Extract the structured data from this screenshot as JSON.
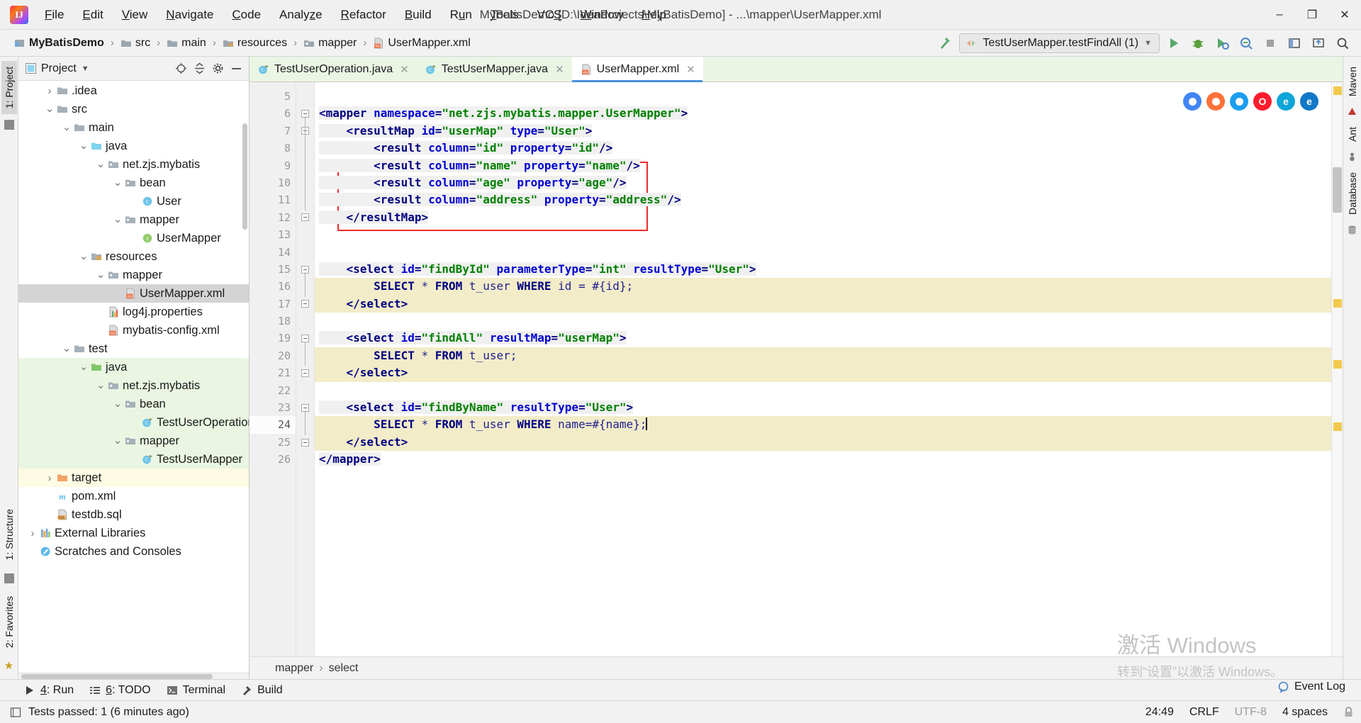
{
  "window": {
    "title": "MyBatisDemo [D:\\IdeaProjects\\MyBatisDemo] - ...\\mapper\\UserMapper.xml",
    "minimize": "–",
    "maximize": "❐",
    "close": "✕"
  },
  "menubar": [
    {
      "label": "File"
    },
    {
      "label": "Edit"
    },
    {
      "label": "View"
    },
    {
      "label": "Navigate"
    },
    {
      "label": "Code"
    },
    {
      "label": "Analyze"
    },
    {
      "label": "Refactor"
    },
    {
      "label": "Build"
    },
    {
      "label": "Run"
    },
    {
      "label": "Tools"
    },
    {
      "label": "VCS"
    },
    {
      "label": "Window"
    },
    {
      "label": "Help"
    }
  ],
  "breadcrumb": [
    {
      "label": "MyBatisDemo",
      "icon": "module-icon"
    },
    {
      "label": "src",
      "icon": "folder-icon"
    },
    {
      "label": "main",
      "icon": "folder-icon"
    },
    {
      "label": "resources",
      "icon": "resources-folder-icon"
    },
    {
      "label": "mapper",
      "icon": "package-folder-icon"
    },
    {
      "label": "UserMapper.xml",
      "icon": "xml-file-icon"
    }
  ],
  "toolbar": {
    "build_icon": "hammer-icon",
    "run_config": "TestUserMapper.testFindAll (1)",
    "run_label": "run-button",
    "debug_label": "debug-button",
    "coverage_label": "run-with-coverage-button",
    "profile_label": "profiler-button",
    "stop_label": "stop-button",
    "layout_label": "layout-button",
    "updates_label": "updates-button",
    "search_label": "search-everywhere-button"
  },
  "left_rail": [
    {
      "label": "1: Project",
      "selected": true
    },
    {
      "label": "1: Structure",
      "selected": false
    },
    {
      "label": "2: Favorites",
      "selected": false
    }
  ],
  "right_rail": [
    {
      "label": "Maven"
    },
    {
      "label": "Ant"
    },
    {
      "label": "Database"
    }
  ],
  "project_panel": {
    "title": "Project",
    "dropdown_icon": "chevron-down-icon",
    "actions": [
      "locate-icon",
      "collapse-all-icon",
      "settings-icon",
      "hide-icon"
    ],
    "tree": [
      {
        "label": ".idea",
        "indent": 1,
        "arrow": "collapsed",
        "icon": "folder-gray",
        "state": ""
      },
      {
        "label": "src",
        "indent": 1,
        "arrow": "expanded",
        "icon": "folder-gray",
        "state": ""
      },
      {
        "label": "main",
        "indent": 2,
        "arrow": "expanded",
        "icon": "folder-gray",
        "state": ""
      },
      {
        "label": "java",
        "indent": 3,
        "arrow": "expanded",
        "icon": "folder-blue",
        "state": ""
      },
      {
        "label": "net.zjs.mybatis",
        "indent": 4,
        "arrow": "expanded",
        "icon": "package",
        "state": ""
      },
      {
        "label": "bean",
        "indent": 5,
        "arrow": "expanded",
        "icon": "package",
        "state": ""
      },
      {
        "label": "User",
        "indent": 6,
        "arrow": "none",
        "icon": "class",
        "state": ""
      },
      {
        "label": "mapper",
        "indent": 5,
        "arrow": "expanded",
        "icon": "package",
        "state": ""
      },
      {
        "label": "UserMapper",
        "indent": 6,
        "arrow": "none",
        "icon": "interface",
        "state": ""
      },
      {
        "label": "resources",
        "indent": 3,
        "arrow": "expanded",
        "icon": "folder-resources",
        "state": ""
      },
      {
        "label": "mapper",
        "indent": 4,
        "arrow": "expanded",
        "icon": "package",
        "state": ""
      },
      {
        "label": "UserMapper.xml",
        "indent": 5,
        "arrow": "none",
        "icon": "xml",
        "state": "sel"
      },
      {
        "label": "log4j.properties",
        "indent": 4,
        "arrow": "none",
        "icon": "properties",
        "state": ""
      },
      {
        "label": "mybatis-config.xml",
        "indent": 4,
        "arrow": "none",
        "icon": "xml",
        "state": ""
      },
      {
        "label": "test",
        "indent": 2,
        "arrow": "expanded",
        "icon": "folder-gray",
        "state": ""
      },
      {
        "label": "java",
        "indent": 3,
        "arrow": "expanded",
        "icon": "folder-green",
        "state": "green"
      },
      {
        "label": "net.zjs.mybatis",
        "indent": 4,
        "arrow": "expanded",
        "icon": "package",
        "state": "green"
      },
      {
        "label": "bean",
        "indent": 5,
        "arrow": "expanded",
        "icon": "package",
        "state": "green"
      },
      {
        "label": "TestUserOperation",
        "indent": 6,
        "arrow": "none",
        "icon": "test-class",
        "state": "green"
      },
      {
        "label": "mapper",
        "indent": 5,
        "arrow": "expanded",
        "icon": "package",
        "state": "green"
      },
      {
        "label": "TestUserMapper",
        "indent": 6,
        "arrow": "none",
        "icon": "test-class",
        "state": "green"
      },
      {
        "label": "target",
        "indent": 1,
        "arrow": "collapsed",
        "icon": "folder-orange",
        "state": "yellow"
      },
      {
        "label": "pom.xml",
        "indent": 1,
        "arrow": "none",
        "icon": "maven",
        "state": ""
      },
      {
        "label": "testdb.sql",
        "indent": 1,
        "arrow": "none",
        "icon": "sql",
        "state": ""
      },
      {
        "label": "External Libraries",
        "indent": 0,
        "arrow": "collapsed",
        "icon": "libraries",
        "state": ""
      },
      {
        "label": "Scratches and Consoles",
        "indent": 0,
        "arrow": "none",
        "icon": "scratches",
        "state": ""
      }
    ]
  },
  "editor": {
    "tabs": [
      {
        "label": "TestUserOperation.java",
        "icon": "test-class-icon",
        "active": false
      },
      {
        "label": "TestUserMapper.java",
        "icon": "test-class-icon",
        "active": false
      },
      {
        "label": "UserMapper.xml",
        "icon": "xml-file-icon",
        "active": true
      }
    ],
    "first_line": 5,
    "lines": [
      {
        "n": 5,
        "fold": "none",
        "sql": false,
        "segs": []
      },
      {
        "n": 6,
        "fold": "open",
        "sql": false,
        "segs": [
          {
            "t": "tag",
            "v": "<mapper "
          },
          {
            "t": "attr",
            "v": "namespace"
          },
          {
            "t": "tag",
            "v": "="
          },
          {
            "t": "val",
            "v": "\"net.zjs.mybatis.mapper.UserMapper\""
          },
          {
            "t": "tag",
            "v": ">"
          }
        ]
      },
      {
        "n": 7,
        "fold": "open",
        "sql": false,
        "segs": [
          {
            "t": "plain",
            "v": "    "
          },
          {
            "t": "tag",
            "v": "<resultMap "
          },
          {
            "t": "attr",
            "v": "id"
          },
          {
            "t": "tag",
            "v": "="
          },
          {
            "t": "val",
            "v": "\"userMap\""
          },
          {
            "t": "plain",
            "v": " "
          },
          {
            "t": "attr",
            "v": "type"
          },
          {
            "t": "tag",
            "v": "="
          },
          {
            "t": "val",
            "v": "\"User\""
          },
          {
            "t": "tag",
            "v": ">"
          }
        ]
      },
      {
        "n": 8,
        "fold": "none",
        "sql": false,
        "segs": [
          {
            "t": "plain",
            "v": "        "
          },
          {
            "t": "tag",
            "v": "<result "
          },
          {
            "t": "attr",
            "v": "column"
          },
          {
            "t": "tag",
            "v": "="
          },
          {
            "t": "val",
            "v": "\"id\""
          },
          {
            "t": "plain",
            "v": " "
          },
          {
            "t": "attr",
            "v": "property"
          },
          {
            "t": "tag",
            "v": "="
          },
          {
            "t": "val",
            "v": "\"id\""
          },
          {
            "t": "tag",
            "v": "/>"
          }
        ]
      },
      {
        "n": 9,
        "fold": "none",
        "sql": false,
        "segs": [
          {
            "t": "plain",
            "v": "        "
          },
          {
            "t": "tag",
            "v": "<result "
          },
          {
            "t": "attr",
            "v": "column"
          },
          {
            "t": "tag",
            "v": "="
          },
          {
            "t": "val",
            "v": "\"name\""
          },
          {
            "t": "plain",
            "v": " "
          },
          {
            "t": "attr",
            "v": "property"
          },
          {
            "t": "tag",
            "v": "="
          },
          {
            "t": "val",
            "v": "\"name\""
          },
          {
            "t": "tag",
            "v": "/>"
          }
        ]
      },
      {
        "n": 10,
        "fold": "none",
        "sql": false,
        "segs": [
          {
            "t": "plain",
            "v": "        "
          },
          {
            "t": "tag",
            "v": "<result "
          },
          {
            "t": "attr",
            "v": "column"
          },
          {
            "t": "tag",
            "v": "="
          },
          {
            "t": "val",
            "v": "\"age\""
          },
          {
            "t": "plain",
            "v": " "
          },
          {
            "t": "attr",
            "v": "property"
          },
          {
            "t": "tag",
            "v": "="
          },
          {
            "t": "val",
            "v": "\"age\""
          },
          {
            "t": "tag",
            "v": "/>"
          }
        ]
      },
      {
        "n": 11,
        "fold": "none",
        "sql": false,
        "segs": [
          {
            "t": "plain",
            "v": "        "
          },
          {
            "t": "tag",
            "v": "<result "
          },
          {
            "t": "attr",
            "v": "column"
          },
          {
            "t": "tag",
            "v": "="
          },
          {
            "t": "val",
            "v": "\"address\""
          },
          {
            "t": "plain",
            "v": " "
          },
          {
            "t": "attr",
            "v": "property"
          },
          {
            "t": "tag",
            "v": "="
          },
          {
            "t": "val",
            "v": "\"address\""
          },
          {
            "t": "tag",
            "v": "/>"
          }
        ]
      },
      {
        "n": 12,
        "fold": "close",
        "sql": false,
        "segs": [
          {
            "t": "plain",
            "v": "    "
          },
          {
            "t": "tag",
            "v": "</resultMap>"
          }
        ]
      },
      {
        "n": 13,
        "fold": "none",
        "sql": false,
        "segs": []
      },
      {
        "n": 14,
        "fold": "none",
        "sql": false,
        "segs": []
      },
      {
        "n": 15,
        "fold": "open",
        "sql": false,
        "segs": [
          {
            "t": "plain",
            "v": "    "
          },
          {
            "t": "tag",
            "v": "<select "
          },
          {
            "t": "attr",
            "v": "id"
          },
          {
            "t": "tag",
            "v": "="
          },
          {
            "t": "val",
            "v": "\"findById\""
          },
          {
            "t": "plain",
            "v": " "
          },
          {
            "t": "attr",
            "v": "parameterType"
          },
          {
            "t": "tag",
            "v": "="
          },
          {
            "t": "val",
            "v": "\"int\""
          },
          {
            "t": "plain",
            "v": " "
          },
          {
            "t": "attr",
            "v": "resultType"
          },
          {
            "t": "tag",
            "v": "="
          },
          {
            "t": "val",
            "v": "\"User\""
          },
          {
            "t": "tag",
            "v": ">"
          }
        ]
      },
      {
        "n": 16,
        "fold": "none",
        "sql": true,
        "segs": [
          {
            "t": "plain",
            "v": "        "
          },
          {
            "t": "kw",
            "v": "SELECT"
          },
          {
            "t": "sqlid",
            "v": " * "
          },
          {
            "t": "kw",
            "v": "FROM"
          },
          {
            "t": "sqlid",
            "v": " t_user "
          },
          {
            "t": "kw",
            "v": "WHERE"
          },
          {
            "t": "sqlid",
            "v": " id = #{id};"
          }
        ]
      },
      {
        "n": 17,
        "fold": "close",
        "sql": true,
        "segs": [
          {
            "t": "plain",
            "v": "    "
          },
          {
            "t": "tag",
            "v": "</select>"
          }
        ]
      },
      {
        "n": 18,
        "fold": "none",
        "sql": false,
        "segs": []
      },
      {
        "n": 19,
        "fold": "open",
        "sql": false,
        "segs": [
          {
            "t": "plain",
            "v": "    "
          },
          {
            "t": "tag",
            "v": "<select "
          },
          {
            "t": "attr",
            "v": "id"
          },
          {
            "t": "tag",
            "v": "="
          },
          {
            "t": "val",
            "v": "\"findAll\""
          },
          {
            "t": "plain",
            "v": " "
          },
          {
            "t": "attr",
            "v": "resultMap"
          },
          {
            "t": "tag",
            "v": "="
          },
          {
            "t": "val",
            "v": "\"userMap\""
          },
          {
            "t": "tag",
            "v": ">"
          }
        ]
      },
      {
        "n": 20,
        "fold": "none",
        "sql": true,
        "segs": [
          {
            "t": "plain",
            "v": "        "
          },
          {
            "t": "kw",
            "v": "SELECT"
          },
          {
            "t": "sqlid",
            "v": " * "
          },
          {
            "t": "kw",
            "v": "FROM"
          },
          {
            "t": "sqlid",
            "v": " t_user;"
          }
        ]
      },
      {
        "n": 21,
        "fold": "close",
        "sql": true,
        "segs": [
          {
            "t": "plain",
            "v": "    "
          },
          {
            "t": "tag",
            "v": "</select>"
          }
        ]
      },
      {
        "n": 22,
        "fold": "none",
        "sql": false,
        "segs": []
      },
      {
        "n": 23,
        "fold": "open",
        "sql": false,
        "segs": [
          {
            "t": "plain",
            "v": "    "
          },
          {
            "t": "tag",
            "v": "<select "
          },
          {
            "t": "attr",
            "v": "id"
          },
          {
            "t": "tag",
            "v": "="
          },
          {
            "t": "val",
            "v": "\"findByName\""
          },
          {
            "t": "plain",
            "v": " "
          },
          {
            "t": "attr",
            "v": "resultType"
          },
          {
            "t": "tag",
            "v": "="
          },
          {
            "t": "val",
            "v": "\"User\""
          },
          {
            "t": "tag",
            "v": ">"
          }
        ]
      },
      {
        "n": 24,
        "fold": "none",
        "sql": true,
        "segs": [
          {
            "t": "plain",
            "v": "        "
          },
          {
            "t": "kw",
            "v": "SELECT"
          },
          {
            "t": "sqlid",
            "v": " * "
          },
          {
            "t": "kw",
            "v": "FROM"
          },
          {
            "t": "sqlid",
            "v": " t_user "
          },
          {
            "t": "kw",
            "v": "WHERE"
          },
          {
            "t": "sqlid",
            "v": " name=#{name};"
          }
        ]
      },
      {
        "n": 25,
        "fold": "close",
        "sql": true,
        "segs": [
          {
            "t": "plain",
            "v": "    "
          },
          {
            "t": "tag",
            "v": "</select>"
          }
        ]
      },
      {
        "n": 26,
        "fold": "none",
        "sql": false,
        "segs": [
          {
            "t": "tag",
            "v": "</mapper>"
          }
        ]
      }
    ],
    "caret_line": 24,
    "browser_icons": [
      {
        "name": "chrome-icon",
        "color": "#4285f4",
        "glyph": "●"
      },
      {
        "name": "firefox-icon",
        "color": "#ff7139",
        "glyph": "●"
      },
      {
        "name": "safari-icon",
        "color": "#1b9df0",
        "glyph": "●"
      },
      {
        "name": "opera-icon",
        "color": "#ff1b2d",
        "glyph": "O"
      },
      {
        "name": "edge-legacy-icon",
        "color": "#0ea5d8",
        "glyph": "e"
      },
      {
        "name": "edge-icon",
        "color": "#1278c8",
        "glyph": "e"
      }
    ],
    "bottom_crumbs": [
      "mapper",
      "select"
    ]
  },
  "tool_windows": [
    {
      "label": "4: Run",
      "num": "4",
      "icon": "run-icon"
    },
    {
      "label": "6: TODO",
      "num": "6",
      "icon": "todo-icon"
    },
    {
      "label": "Terminal",
      "num": "",
      "icon": "terminal-icon"
    },
    {
      "label": "Build",
      "num": "",
      "icon": "hammer-icon"
    }
  ],
  "statusbar": {
    "message": "Tests passed: 1 (6 minutes ago)",
    "message_icon": "notification-icon",
    "caret_position": "24:49",
    "line_separator": "CRLF",
    "encoding": "UTF-8",
    "indent": "4 spaces",
    "event_log": "Event Log",
    "event_log_icon": "balloon-icon",
    "lock_icon": "lock-icon"
  },
  "watermark": {
    "line1": "激活 Windows",
    "line2": "转到“设置”以激活 Windows。"
  },
  "colors": {
    "accent": "#4a90d9",
    "red_box": "#ee2b2b",
    "sql_highlight": "#f2ecc9",
    "test_root": "#eaf6e1",
    "excluded": "#fdfbe3"
  }
}
